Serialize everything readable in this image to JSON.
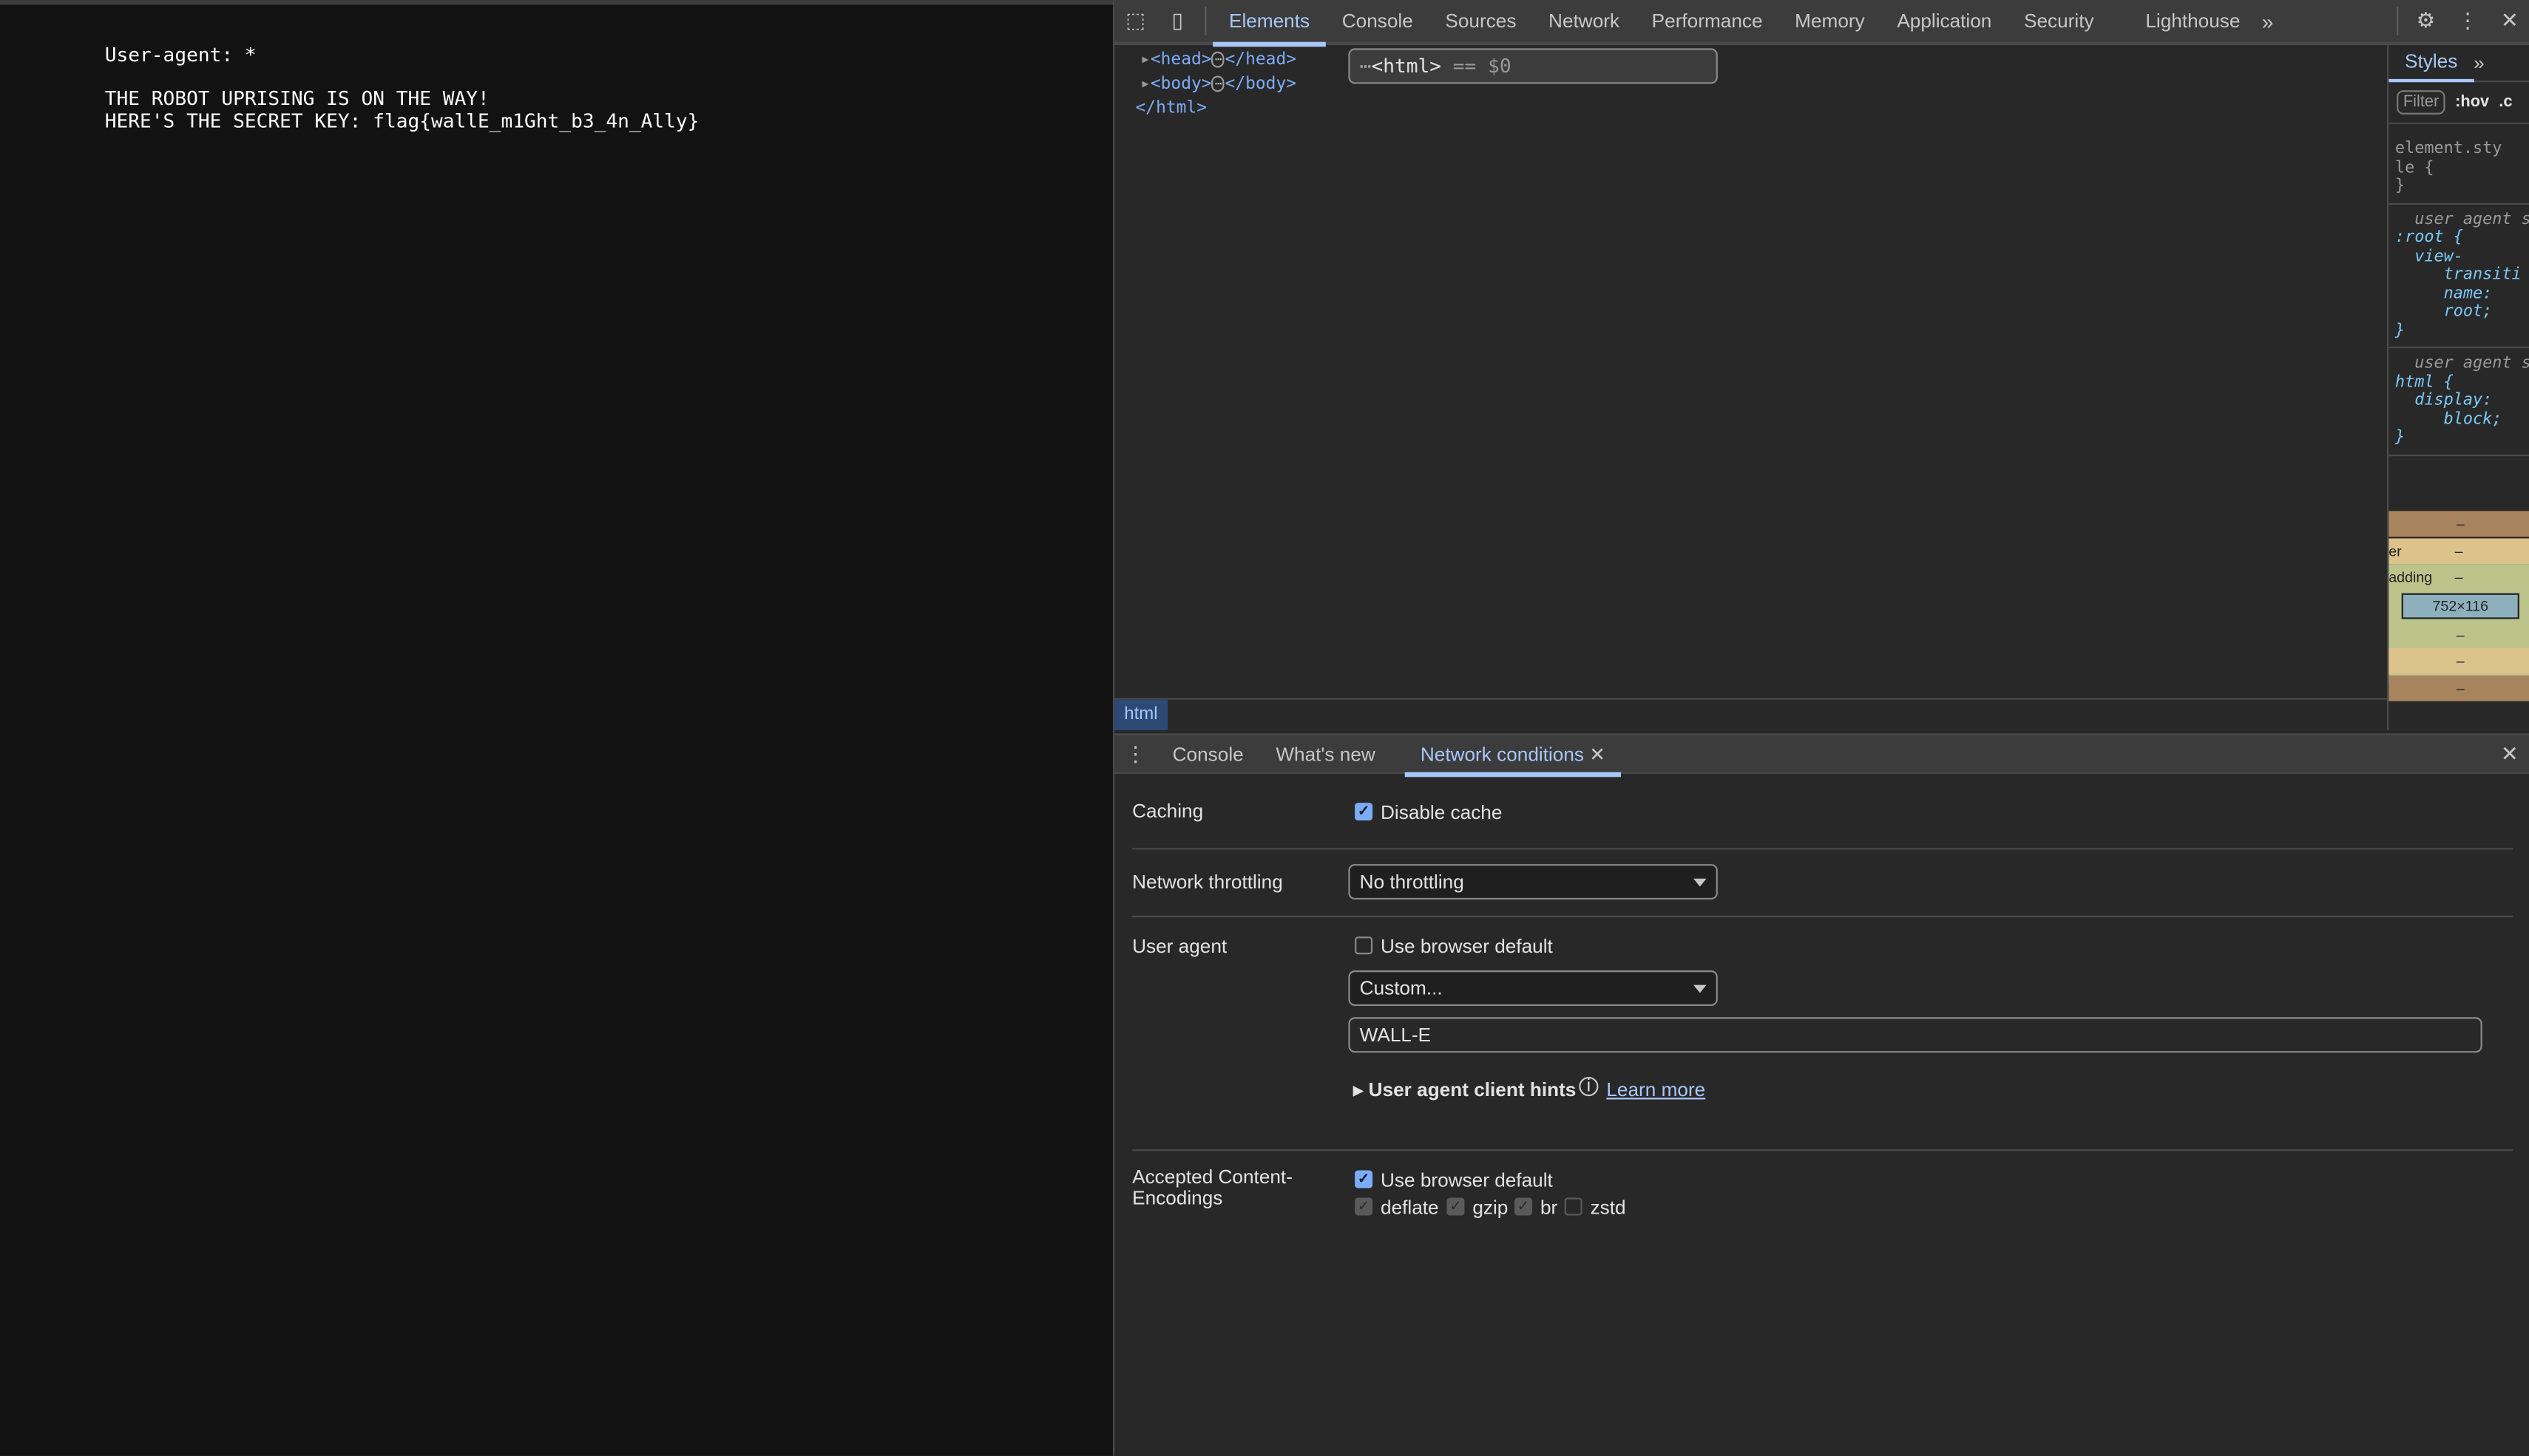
{
  "page": {
    "lines": [
      "User-agent: *",
      "",
      "THE ROBOT UPRISING IS ON THE WAY!",
      "HERE'S THE SECRET KEY: flag{wallE_m1Ght_b3_4n_Ally}"
    ]
  },
  "devtools": {
    "tabs": [
      "Elements",
      "Console",
      "Sources",
      "Network",
      "Performance",
      "Memory",
      "Application",
      "Security",
      "Lighthouse"
    ],
    "active_tab": "Elements",
    "dom": {
      "html_open": "<html>",
      "selected_marker": "== $0",
      "head": "<head>",
      "head_close": "</head>",
      "body": "<body>",
      "body_close": "</body>",
      "html_close": "</html>"
    },
    "breadcrumb": "html",
    "styles": {
      "tab": "Styles",
      "filter_placeholder": "Filter",
      "hov": ":hov",
      "cls": ".c",
      "rule1": "element.sty\nle {\n}",
      "rule2_origin": "  user agent s",
      "rule2": ":root {\n  view-\n     transiti\n     name:\n     root;\n}",
      "rule3_origin": "  user agent s",
      "rule3": "html {\n  display:\n     block;\n}",
      "box_dash": "–",
      "box_border": "er",
      "box_padding": "adding",
      "box_size": "752×116"
    },
    "drawer": {
      "tabs": [
        "Console",
        "What's new",
        "Network conditions"
      ],
      "active_tab": "Network conditions"
    },
    "network_conditions": {
      "caching_label": "Caching",
      "disable_cache_label": "Disable cache",
      "disable_cache_checked": true,
      "throttling_label": "Network throttling",
      "throttling_value": "No throttling",
      "user_agent_label": "User agent",
      "ua_browser_default_label": "Use browser default",
      "ua_browser_default_checked": false,
      "ua_preset_value": "Custom...",
      "ua_value": "WALL-E",
      "client_hints_label": "User agent client hints",
      "learn_more": "Learn more",
      "encodings_label_1": "Accepted Content-",
      "encodings_label_2": "Encodings",
      "enc_browser_default_label": "Use browser default",
      "enc_browser_default_checked": true,
      "encodings": [
        {
          "name": "deflate",
          "checked": true
        },
        {
          "name": "gzip",
          "checked": true
        },
        {
          "name": "br",
          "checked": true
        },
        {
          "name": "zstd",
          "checked": false
        }
      ]
    },
    "accent_color": "#a8c7fa"
  }
}
